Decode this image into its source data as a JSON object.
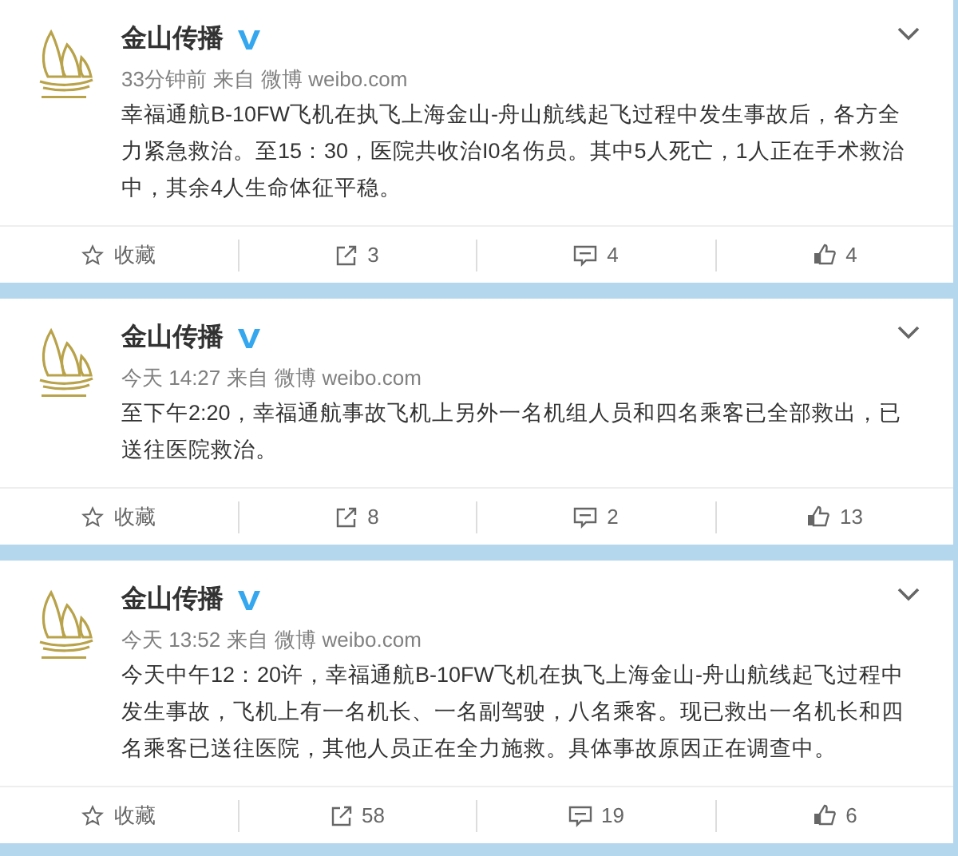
{
  "posts": [
    {
      "author": "金山传播",
      "verified": true,
      "time": "33分钟前",
      "source_prefix": "来自",
      "source": "微博 weibo.com",
      "text_lines": [
        "幸福通航B-10FW飞机在执飞上海金山-舟山航线起飞过程中发生事故后，各方全",
        "力紧急救治。至15：30，医院共收治I0名伤员。其中5人死亡，1人正在手术救治",
        "中，其余4人生命体征平稳。"
      ],
      "favorite": "收藏",
      "reposts": "3",
      "comments": "4",
      "likes": "4"
    },
    {
      "author": "金山传播",
      "verified": true,
      "time": "今天 14:27",
      "source_prefix": "来自",
      "source": "微博 weibo.com",
      "text_lines": [
        "至下午2:20，幸福通航事故飞机上另外一名机组人员和四名乘客已全部救出，已",
        "送往医院救治。"
      ],
      "favorite": "收藏",
      "reposts": "8",
      "comments": "2",
      "likes": "13"
    },
    {
      "author": "金山传播",
      "verified": true,
      "time": "今天 13:52",
      "source_prefix": "来自",
      "source": "微博 weibo.com",
      "text_lines": [
        "今天中午12：20许，幸福通航B-10FW飞机在执飞上海金山-舟山航线起飞过程中",
        "发生事故，飞机上有一名机长、一名副驾驶，八名乘客。现已救出一名机长和四",
        "名乘客已送往医院，其他人员正在全力施救。具体事故原因正在调查中。"
      ],
      "favorite": "收藏",
      "reposts": "58",
      "comments": "19",
      "likes": "6"
    }
  ]
}
